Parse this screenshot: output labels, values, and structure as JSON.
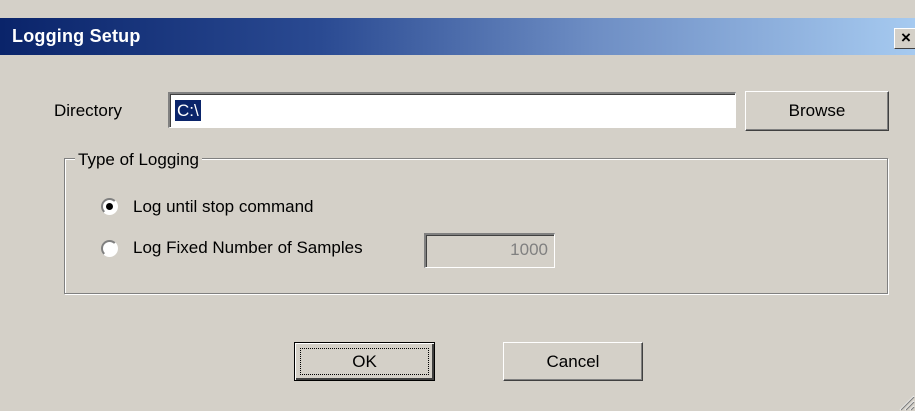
{
  "window": {
    "title": "Logging Setup",
    "close_glyph": "×",
    "close_icon": "close-icon"
  },
  "directory": {
    "label": "Directory",
    "value": "C:\\",
    "browse_label": "Browse"
  },
  "logging_type": {
    "group_label": "Type of Logging",
    "options": [
      {
        "label": "Log until stop command",
        "selected": true
      },
      {
        "label": "Log Fixed Number of Samples",
        "selected": false
      }
    ],
    "samples_value": "1000"
  },
  "buttons": {
    "ok_label": "OK",
    "cancel_label": "Cancel"
  },
  "colors": {
    "titlebar_start": "#0a246a",
    "titlebar_end": "#a6caf0",
    "dialog_bg": "#d4d0c8",
    "selection": "#0a246a"
  }
}
